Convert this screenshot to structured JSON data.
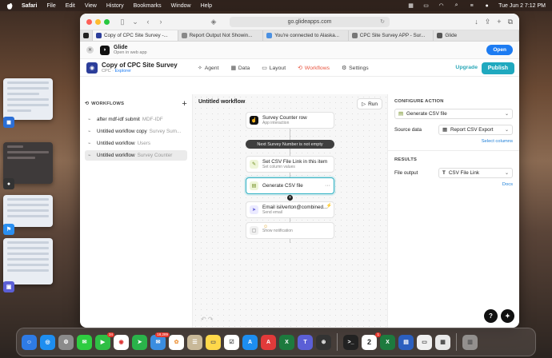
{
  "menubar": {
    "items": [
      "Safari",
      "File",
      "Edit",
      "View",
      "History",
      "Bookmarks",
      "Window",
      "Help"
    ],
    "datetime": "Tue Jun 2  7:12 PM"
  },
  "browser": {
    "address": "go.glideapps.com",
    "tabs": [
      {
        "label": "Copy of CPC Site Survey -..."
      },
      {
        "label": "Report Output Not Showin..."
      },
      {
        "label": "You're connected to Alaska..."
      },
      {
        "label": "CPC Site Survey APP - Sur..."
      },
      {
        "label": "Glide"
      }
    ]
  },
  "banner": {
    "title": "Glide",
    "subtitle": "Open in web app",
    "open_label": "Open"
  },
  "app": {
    "name": "Copy of CPC Site Survey",
    "org": "CPC",
    "org_sep": " · ",
    "mode": "Explorer",
    "nav": [
      "Agent",
      "Data",
      "Layout",
      "Workflows",
      "Settings"
    ],
    "upgrade_label": "Upgrade",
    "publish_label": "Publish"
  },
  "sidebar": {
    "heading": "WORKFLOWS",
    "items": [
      {
        "name": "after mdf-idf submit",
        "sub": "MDF-IDF"
      },
      {
        "name": "Untitled workflow copy",
        "sub": "Survey Sum..."
      },
      {
        "name": "Untitled workflow",
        "sub": "Users"
      },
      {
        "name": "Untitled workflow",
        "sub": "Survey Counter"
      }
    ]
  },
  "canvas": {
    "title": "Untitled workflow",
    "run_label": "Run",
    "trigger": {
      "title": "Survey Counter row",
      "sub": "App interaction"
    },
    "condition": "Next Survey Number is not empty",
    "steps": [
      {
        "title": "Set CSV File Link in this item",
        "sub": "Set column values"
      },
      {
        "title": "Generate CSV file",
        "sub": ""
      },
      {
        "title": "Email isilverton@combined...",
        "sub": "Send email"
      },
      {
        "title": "",
        "sub": "Show notification"
      }
    ]
  },
  "panel": {
    "configure_heading": "CONFIGURE ACTION",
    "action_value": "Generate CSV file",
    "source_label": "Source data",
    "source_value": "Report CSV Export",
    "select_columns": "Select columns",
    "results_heading": "RESULTS",
    "output_label": "File output",
    "output_value": "CSV File Link",
    "docs_label": "Docs"
  },
  "dock": {
    "badges": {
      "mail": "18,289",
      "calendar_date": "2",
      "cal_badge": "1",
      "facetime": "34"
    }
  }
}
